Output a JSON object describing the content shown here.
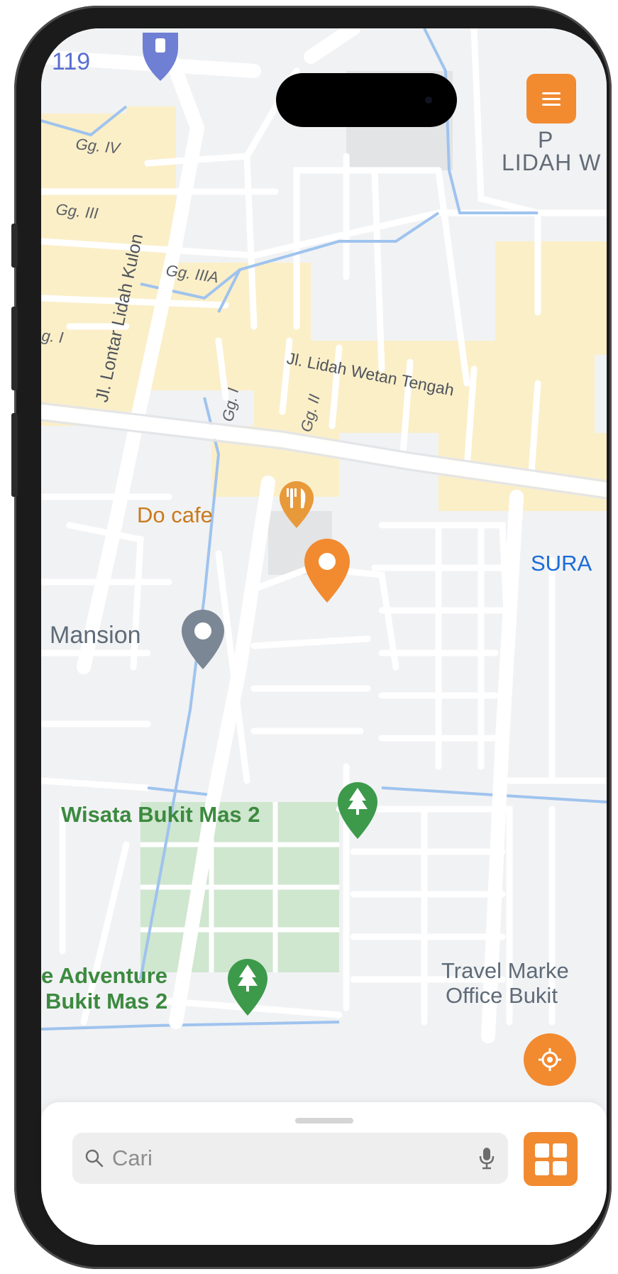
{
  "map": {
    "labels": {
      "route_number": "119",
      "lidah_top": "LIDAH W",
      "p_partial": "P",
      "gg_iv": "Gg. IV",
      "gg_iii": "Gg. III",
      "gg_iiia": "Gg. IIIA",
      "gg_i_left": "g. I",
      "gg_i": "Gg. I",
      "gg_ii": "Gg. II",
      "jl_lontar": "Jl. Lontar Lidah Kulon",
      "jl_lidah_wetan": "Jl. Lidah Wetan Tengah",
      "sura": "SURA",
      "do_cafe": "Do cafe",
      "mansion": "Mansion",
      "wisata": "Wisata Bukit Mas 2",
      "adventure_line1": "e Adventure",
      "adventure_line2": "Bukit Mas 2",
      "travel_line1": "Travel Marke",
      "travel_line2": "Office Bukit"
    }
  },
  "search": {
    "placeholder": "Cari"
  },
  "colors": {
    "accent": "#f28a30",
    "park_green": "#3c8a3f",
    "restaurant_orange": "#c97a1c",
    "district_blue": "#1a6cd8",
    "place_gray": "#5f6b78"
  },
  "icons": {
    "menu": "menu-icon",
    "locate": "locate-icon",
    "search": "search-icon",
    "mic": "mic-icon",
    "grid": "grid-icon",
    "restaurant_pin": "restaurant-pin-icon",
    "location_pin": "location-pin-icon",
    "place_pin": "place-pin-icon",
    "tree_pin": "tree-pin-icon",
    "transit_pin": "transit-pin-icon"
  }
}
